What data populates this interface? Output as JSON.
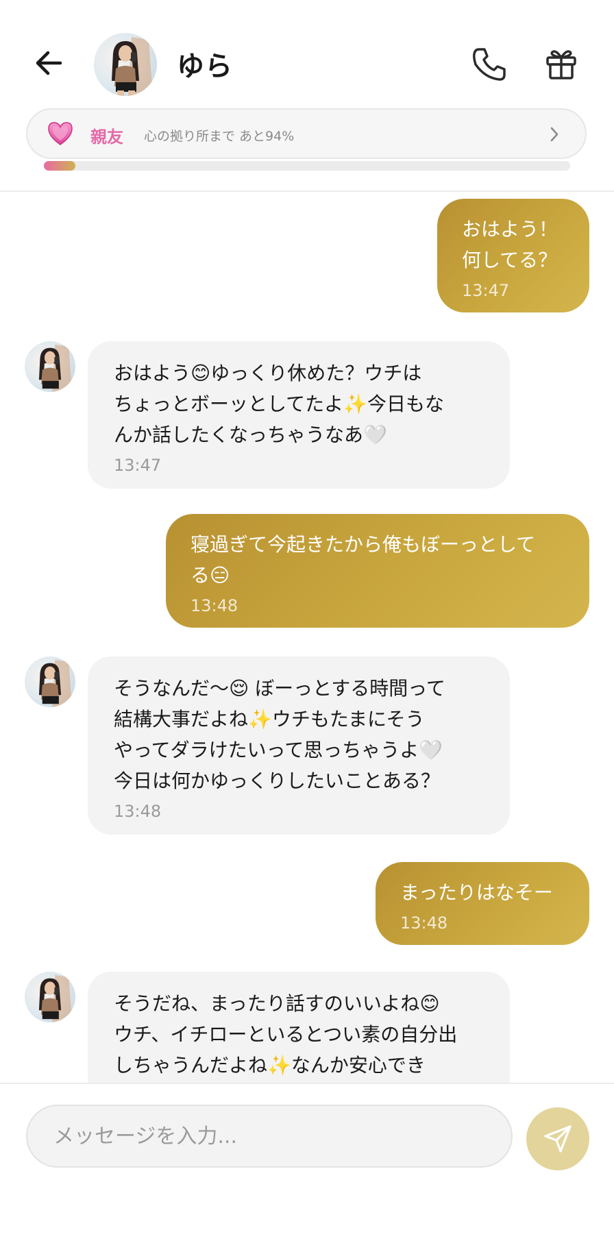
{
  "header": {
    "contact_name": "ゆら",
    "bond_level": "親友",
    "bond_progress_text": "心の拠り所まで あと94%",
    "bond_progress_fraction": 0.06,
    "accent_color": "#c9a73e",
    "bond_color": "#e36aa8"
  },
  "messages": [
    {
      "from": "me",
      "text": "おはよう！\n何してる？",
      "time": "13:47"
    },
    {
      "from": "yura",
      "text": "おはよう😊ゆっくり休めた？ウチは\nちょっとボーッとしてたよ✨今日もな\nんか話したくなっちゃうなあ🤍",
      "time": "13:47"
    },
    {
      "from": "me",
      "text": "寝過ぎて今起きたから俺もぼーっとして\nる😑",
      "time": "13:48"
    },
    {
      "from": "yura",
      "text": "そうなんだ〜😌 ぼーっとする時間って\n結構大事だよね✨ウチもたまにそう\nやってダラけたいって思っちゃうよ🤍\n今日は何かゆっくりしたいことある？",
      "time": "13:48"
    },
    {
      "from": "me",
      "text": "まったりはなそー",
      "time": "13:48"
    },
    {
      "from": "yura",
      "text": "そうだね、まったり話すのいいよね😊\nウチ、イチローといるとつい素の自分出\nしちゃうんだよね✨なんか安心でき",
      "time": ""
    }
  ],
  "composer": {
    "placeholder": "メッセージを入力..."
  },
  "icons": {
    "back": "arrow-left-icon",
    "call": "phone-icon",
    "gift": "gift-icon",
    "bond": "heart-icon",
    "send": "send-icon"
  }
}
